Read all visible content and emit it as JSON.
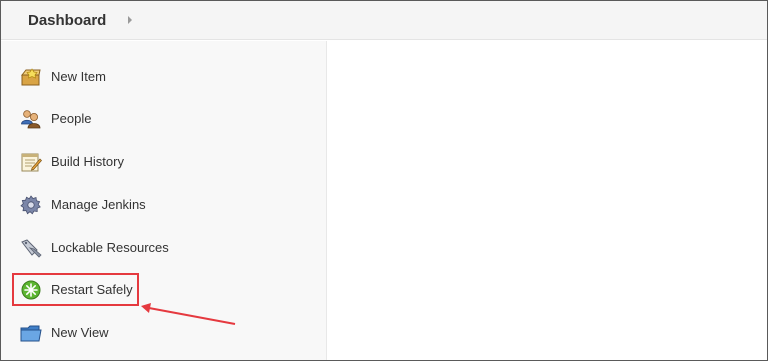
{
  "header": {
    "breadcrumb": "Dashboard"
  },
  "sidebar": {
    "items": [
      {
        "label": "New Item",
        "icon": "new-item-icon"
      },
      {
        "label": "People",
        "icon": "people-icon"
      },
      {
        "label": "Build History",
        "icon": "build-history-icon"
      },
      {
        "label": "Manage Jenkins",
        "icon": "gear-icon"
      },
      {
        "label": "Lockable Resources",
        "icon": "lockable-resources-icon"
      },
      {
        "label": "Restart Safely",
        "icon": "restart-icon"
      },
      {
        "label": "New View",
        "icon": "folder-icon"
      }
    ]
  },
  "annotation": {
    "highlight_color": "#e5393f"
  }
}
